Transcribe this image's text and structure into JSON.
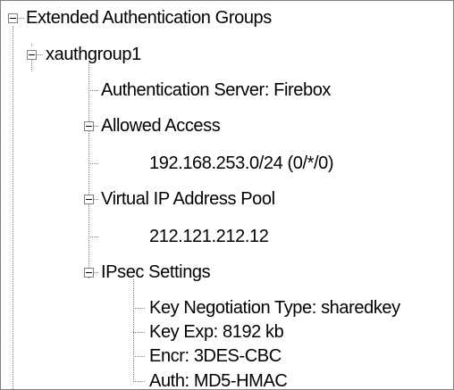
{
  "tree": {
    "root_label": "Extended Authentication Groups",
    "group_label": "xauthgroup1",
    "auth_server": "Authentication Server: Firebox",
    "allowed_access": "Allowed Access",
    "allowed_value": "192.168.253.0/24 (0/*/0)",
    "vip_pool": "Virtual IP Address Pool",
    "vip_value": "212.121.212.12",
    "ipsec": "IPsec Settings",
    "key_negotiation": "Key Negotiation Type: sharedkey",
    "key_exp": "Key Exp: 8192 kb",
    "encr": "Encr: 3DES-CBC",
    "auth": "Auth: MD5-HMAC"
  }
}
